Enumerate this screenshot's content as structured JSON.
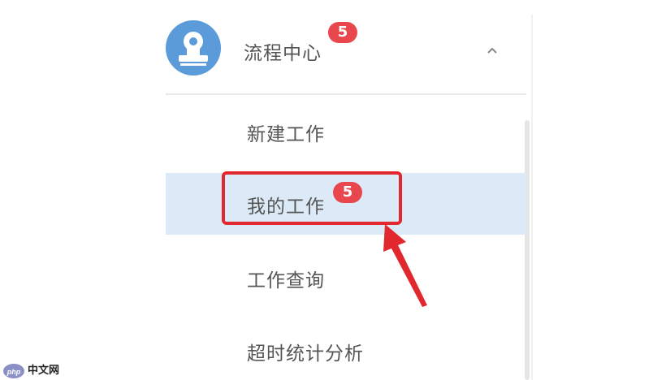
{
  "header": {
    "title": "流程中心",
    "badge_count": "5",
    "expanded": true
  },
  "menu": {
    "items": [
      {
        "label": "新建工作",
        "selected": false
      },
      {
        "label": "我的工作",
        "selected": true,
        "badge": "5"
      },
      {
        "label": "工作查询",
        "selected": false
      },
      {
        "label": "超时统计分析",
        "selected": false
      }
    ]
  },
  "watermark": {
    "text": "中文网"
  },
  "colors": {
    "avatar": "#5b9bd9",
    "badge": "#e8474d",
    "selected_row": "#dbeaf6",
    "annotation": "#e0282e",
    "text": "#555555"
  }
}
